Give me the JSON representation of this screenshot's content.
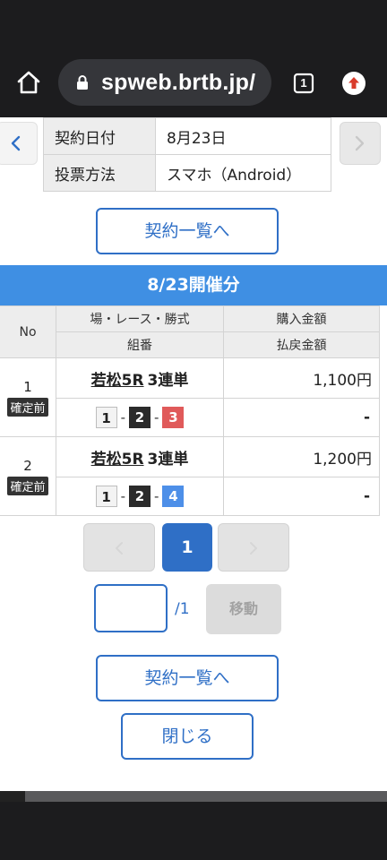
{
  "browser": {
    "url": "spweb.brtb.jp/",
    "tab_count": "1"
  },
  "contract_info": {
    "rows": [
      {
        "label": "契約日付",
        "value": "8月23日"
      },
      {
        "label": "投票方法",
        "value": "スマホ（Android）"
      }
    ]
  },
  "buttons": {
    "contract_list": "契約一覧へ",
    "close": "閉じる",
    "move": "移動"
  },
  "section_title": "8/23開催分",
  "table": {
    "headers": {
      "no": "No",
      "race": "場・レース・勝式",
      "combo": "組番",
      "purchase": "購入金額",
      "refund": "払戻金額"
    },
    "rows": [
      {
        "no": "1",
        "status": "確定前",
        "venue_race": "若松5R",
        "bet_type": "3連単",
        "combo": [
          "1",
          "2",
          "3"
        ],
        "purchase": "1,100円",
        "refund": "-"
      },
      {
        "no": "2",
        "status": "確定前",
        "venue_race": "若松5R",
        "bet_type": "3連単",
        "combo": [
          "1",
          "2",
          "4"
        ],
        "purchase": "1,200円",
        "refund": "-"
      }
    ]
  },
  "pagination": {
    "current_page": "1",
    "total_label": "/1",
    "input_value": ""
  },
  "colors": {
    "accent": "#2f6fc6",
    "header_bar": "#3f8fe3",
    "boat_1": "#f3f3f3",
    "boat_2": "#2b2b2b",
    "boat_3": "#e05a5a",
    "boat_4": "#4d8fe8"
  }
}
